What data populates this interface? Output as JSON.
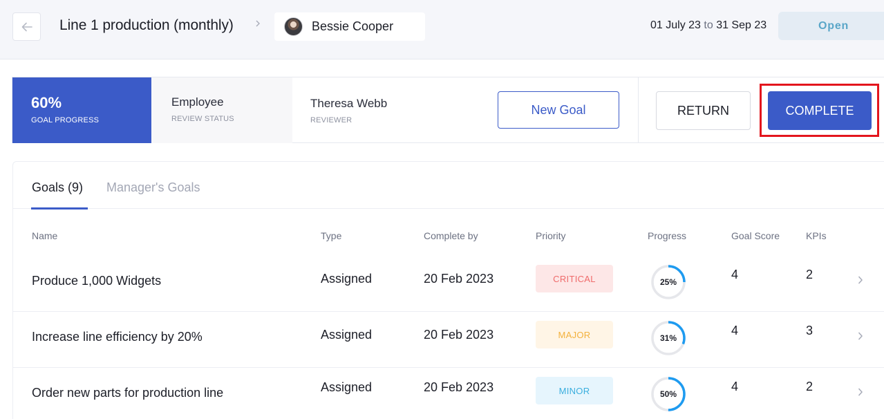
{
  "header": {
    "back_icon": "arrow-left-icon",
    "title": "Line 1 production (monthly)",
    "separator_icon": "chevron-right-icon",
    "employee_name": "Bessie Cooper",
    "date_start": "01 July 23",
    "date_to": "to",
    "date_end": "31 Sep 23",
    "status": "Open"
  },
  "summary": {
    "progress_value": "60%",
    "progress_fraction": 0.6,
    "progress_label": "GOAL PROGRESS",
    "review_status_value": "Employee",
    "review_status_label": "REVIEW STATUS",
    "reviewer_name": "Theresa Webb",
    "reviewer_label": "REVIEWER",
    "new_goal_label": "New Goal",
    "return_label": "RETURN",
    "complete_label": "COMPLETE"
  },
  "tabs": {
    "goals": "Goals (9)",
    "manager_goals": "Manager's Goals"
  },
  "table": {
    "columns": [
      "Name",
      "Type",
      "Complete by",
      "Priority",
      "Progress",
      "Goal Score",
      "KPIs"
    ],
    "rows": [
      {
        "name": "Produce 1,000 Widgets",
        "type": "Assigned",
        "complete_by": "20 Feb 2023",
        "priority": "CRITICAL",
        "progress": 25,
        "progress_label": "25%",
        "goal_score": "4",
        "kpis": "2"
      },
      {
        "name": "Increase line efficiency by 20%",
        "type": "Assigned",
        "complete_by": "20 Feb 2023",
        "priority": "MAJOR",
        "progress": 31,
        "progress_label": "31%",
        "goal_score": "4",
        "kpis": "3"
      },
      {
        "name": "Order new parts for production line",
        "type": "Assigned",
        "complete_by": "20 Feb 2023",
        "priority": "MINOR",
        "progress": 50,
        "progress_label": "50%",
        "goal_score": "4",
        "kpis": "2"
      }
    ]
  },
  "colors": {
    "primary": "#3b5bc8",
    "highlight": "#e3151d",
    "ring_progress": "#1e9bf0",
    "ring_track": "#e6e7eb",
    "critical_bg": "#fde7e7",
    "critical_text": "#ef6b6b",
    "major_bg": "#fff5e6",
    "major_text": "#f3b13c",
    "minor_bg": "#e6f5fd",
    "minor_text": "#3aaede"
  }
}
